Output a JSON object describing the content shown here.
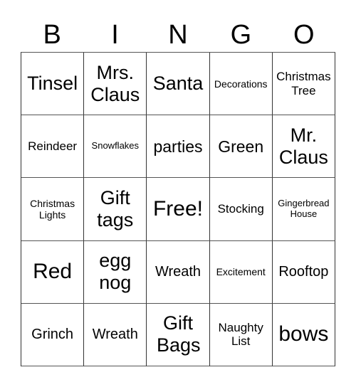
{
  "header": {
    "letters": [
      "B",
      "I",
      "N",
      "G",
      "O"
    ]
  },
  "grid": {
    "rows": [
      [
        "Tinsel",
        "Mrs. Claus",
        "Santa",
        "Decorations",
        "Christmas Tree"
      ],
      [
        "Reindeer",
        "Snowflakes",
        "parties",
        "Green",
        "Mr. Claus"
      ],
      [
        "Christmas Lights",
        "Gift tags",
        "Free!",
        "Stocking",
        "Gingerbread House"
      ],
      [
        "Red",
        "egg nog",
        "Wreath",
        "Excitement",
        "Rooftop"
      ],
      [
        "Grinch",
        "Wreath",
        "Gift Bags",
        "Naughty List",
        "bows"
      ]
    ],
    "free_space": "Free!"
  },
  "colors": {
    "background": "#ffffff",
    "text": "#000000",
    "grid_line": "#444444"
  }
}
